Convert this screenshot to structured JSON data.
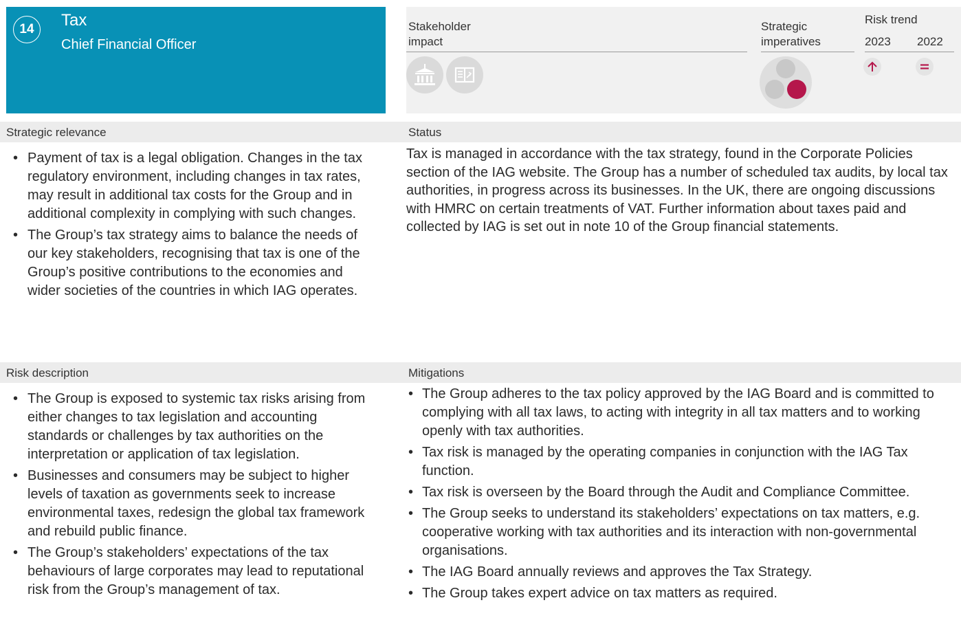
{
  "header": {
    "number": "14",
    "title": "Tax",
    "owner": "Chief Financial Officer"
  },
  "columns": {
    "stakeholder_impact": "Stakeholder impact",
    "strategic_imperatives": "Strategic imperatives",
    "risk_trend": "Risk trend",
    "year_current": "2023",
    "year_previous": "2022"
  },
  "stakeholder_icons": [
    "government-building-icon",
    "booklet-icon"
  ],
  "trend": {
    "2023": "increasing",
    "2022": "unchanged",
    "accent_color": "#b5174b"
  },
  "colors": {
    "header_bg": "#0891b6",
    "panel_bg": "#f1f1f1",
    "section_bg": "#ececec",
    "highlight": "#b5174b"
  },
  "sections": {
    "strategic_relevance": {
      "label": "Strategic relevance",
      "items": [
        "Payment of tax is a legal obligation. Changes in the tax regulatory environment, including changes in tax rates, may result in additional tax costs for the Group and in additional complexity in complying with such changes.",
        "The Group’s tax strategy aims to balance the needs of our key stakeholders, recognising that tax is one of the Group’s positive contributions to the economies and wider societies of the countries in which IAG operates."
      ]
    },
    "status": {
      "label": "Status",
      "text": "Tax is managed in accordance with the tax strategy, found in the Corporate Policies section of the IAG website. The Group has a number of scheduled tax audits, by local tax authorities, in progress across its businesses. In the UK, there are ongoing discussions with HMRC on certain treatments of VAT. Further information about taxes paid and collected by IAG is set out in note 10 of the Group financial statements."
    },
    "risk_description": {
      "label": "Risk description",
      "items": [
        "The Group is exposed to systemic tax risks arising from either changes to tax legislation and accounting standards or challenges by tax authorities on the interpretation or application of tax legislation.",
        "Businesses and consumers may be subject to higher levels of taxation as governments seek to increase environmental taxes, redesign the global tax framework and rebuild public finance.",
        "The Group’s stakeholders’ expectations of the tax behaviours of large corporates may lead to reputational risk from the Group’s management of tax."
      ]
    },
    "mitigations": {
      "label": "Mitigations",
      "items": [
        "The Group adheres to the tax policy approved by the IAG Board and is committed to complying with all tax laws, to acting with integrity in all tax matters and to working openly with tax authorities.",
        "Tax risk is managed by the operating companies in conjunction with the IAG Tax function.",
        "Tax risk is overseen by the Board through the Audit and Compliance Committee.",
        "The Group seeks to understand its stakeholders’ expectations on tax matters, e.g. cooperative working with tax authorities and its interaction with non-governmental organisations.",
        "The IAG Board annually reviews and approves the Tax Strategy.",
        "The Group takes expert advice on tax matters as required."
      ]
    }
  }
}
